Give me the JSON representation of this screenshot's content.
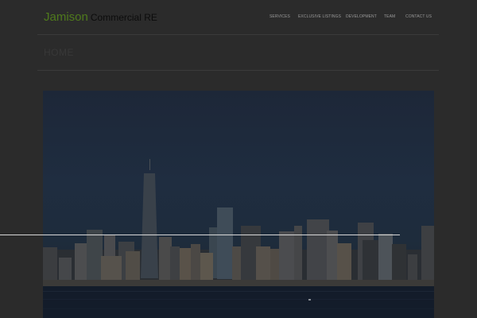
{
  "logo": {
    "primary": "Jamison",
    "secondary": "Commercial RE"
  },
  "nav": {
    "services": "SERVICES",
    "exclusive_listings": "EXCLUSIVE LISTINGS",
    "development": "DEVELOPMENT",
    "team": "TEAM",
    "contact_us": "CONTACT US"
  },
  "page": {
    "title": "HOME"
  },
  "colors": {
    "background": "#2b2b2b",
    "logo_accent": "#4f7a1c",
    "nav_text": "#9a9a9a"
  }
}
